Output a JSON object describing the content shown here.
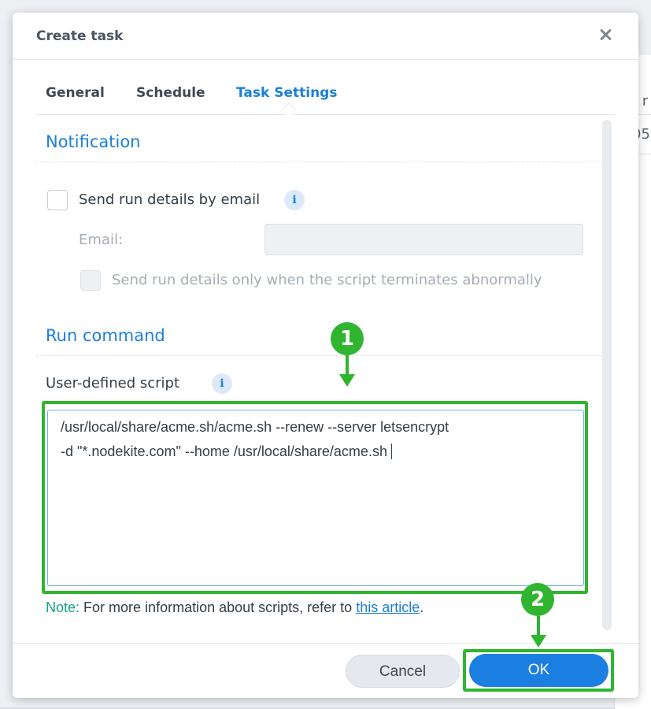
{
  "background": {
    "peek_text_1": "t r",
    "peek_text_2": "05"
  },
  "dialog": {
    "title": "Create task",
    "close_icon": "close-icon"
  },
  "tabs": [
    {
      "label": "General",
      "active": false
    },
    {
      "label": "Schedule",
      "active": false
    },
    {
      "label": "Task Settings",
      "active": true
    }
  ],
  "notification": {
    "section_title": "Notification",
    "send_email_label": "Send run details by email",
    "send_email_checked": false,
    "email_label": "Email:",
    "email_value": "",
    "abnormal_only_label": "Send run details only when the script terminates abnormally",
    "abnormal_only_checked": false,
    "info_icon": "info-icon"
  },
  "run_command": {
    "section_title": "Run command",
    "script_label": "User-defined script",
    "script_line_1": "/usr/local/share/acme.sh/acme.sh --renew --server letsencrypt",
    "script_line_2": "-d \"*.nodekite.com\" --home /usr/local/share/acme.sh"
  },
  "note": {
    "prefix": "Note:",
    "text": "For more information about scripts, refer to",
    "link_text": "this article",
    "suffix": "."
  },
  "footer": {
    "cancel_label": "Cancel",
    "ok_label": "OK"
  },
  "annotations": {
    "marker_1": "1",
    "marker_2": "2",
    "highlight_color": "#2fb52f"
  },
  "colors": {
    "accent": "#1a7fd9",
    "note": "#14a187"
  }
}
